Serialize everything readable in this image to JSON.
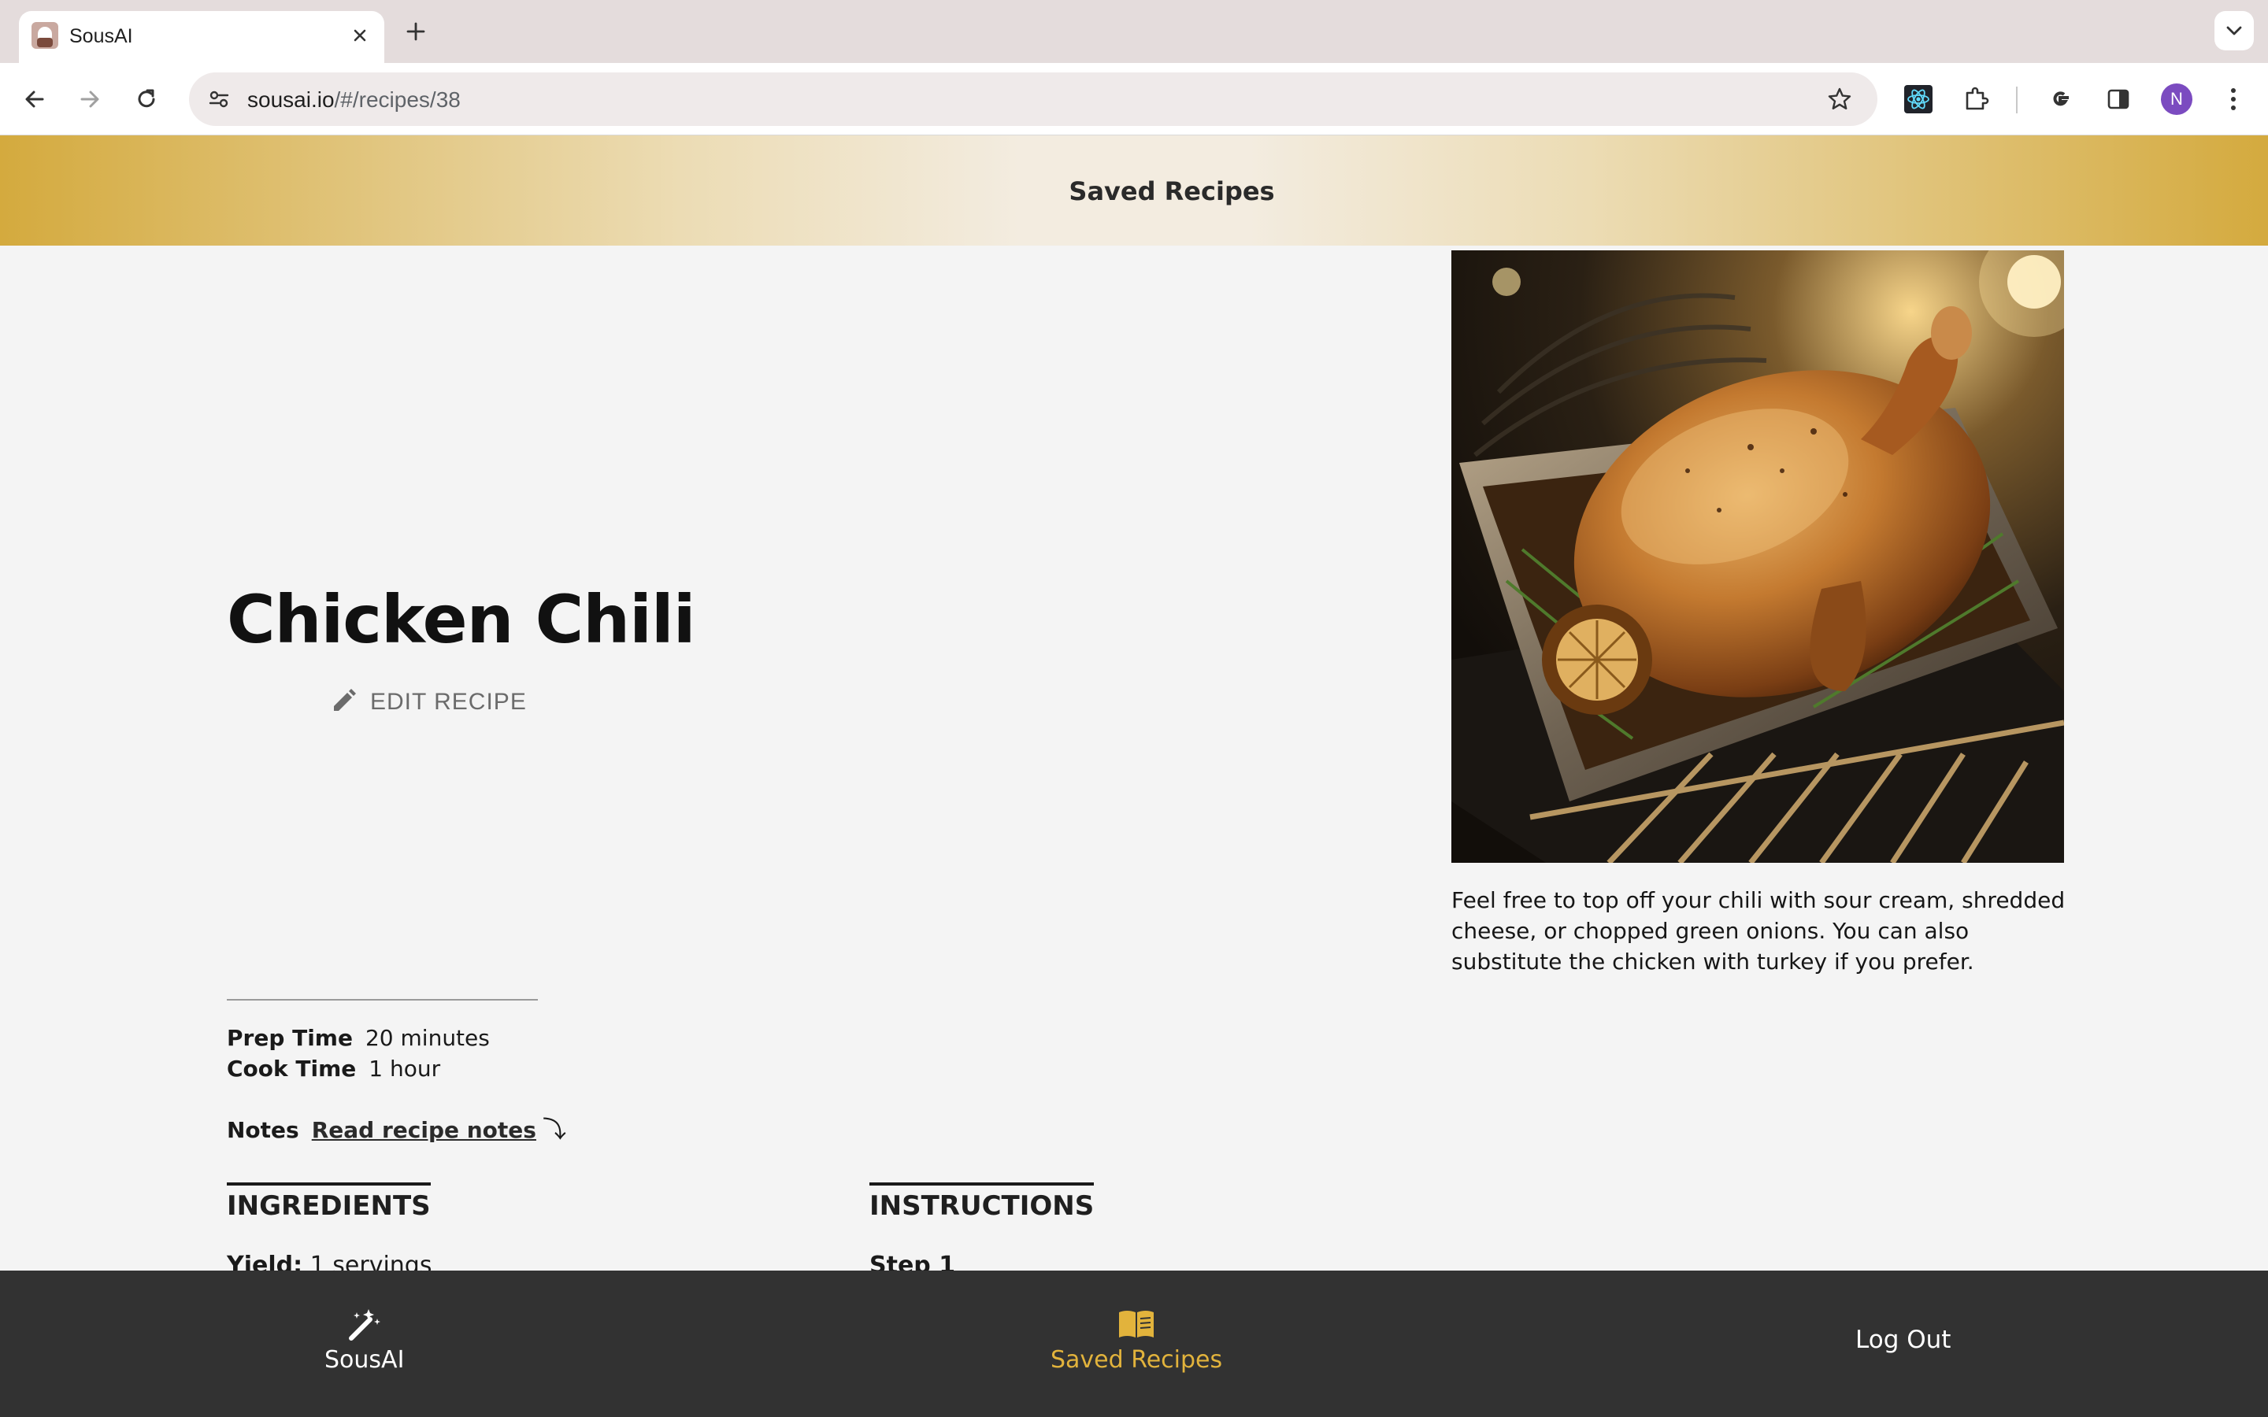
{
  "browser": {
    "tab_title": "SousAI",
    "url_host": "sousai.io",
    "url_path": "/#/recipes/38",
    "avatar_letter": "N"
  },
  "header": {
    "title": "Saved Recipes"
  },
  "recipe": {
    "title": "Chicken Chili",
    "edit_label": "EDIT RECIPE",
    "image_notes": "Feel free to top off your chili with sour cream, shredded cheese, or chopped green onions. You can also substitute the chicken with turkey if you prefer.",
    "prep_time_label": "Prep Time",
    "prep_time_value": "20 minutes",
    "cook_time_label": "Cook Time",
    "cook_time_value": "1 hour",
    "notes_label": "Notes",
    "notes_link": "Read recipe notes",
    "notes_arrow": "⤵"
  },
  "ingredients": {
    "heading": "INGREDIENTS",
    "yield_label": "Yield:",
    "yield_value": "1 servings"
  },
  "instructions": {
    "heading": "INSTRUCTIONS",
    "first_step": "Step 1"
  },
  "bottom_nav": {
    "home_label": "SousAI",
    "saved_label": "Saved Recipes",
    "logout_label": "Log Out",
    "active_color": "#e2b33c",
    "inactive_color": "#ffffff"
  },
  "icons": {
    "favicon": "sousai-chef-favicon",
    "back": "arrow-left-icon",
    "forward": "arrow-right-icon",
    "reload": "reload-icon",
    "site_info": "tune-icon",
    "bookmark": "star-icon",
    "react_devtools": "react-icon",
    "extensions": "puzzle-icon",
    "google": "google-g-icon",
    "side_panel": "side-panel-icon",
    "menu": "kebab-menu-icon",
    "edit": "pencil-icon",
    "magic": "magic-wand-icon",
    "book": "open-book-icon"
  }
}
